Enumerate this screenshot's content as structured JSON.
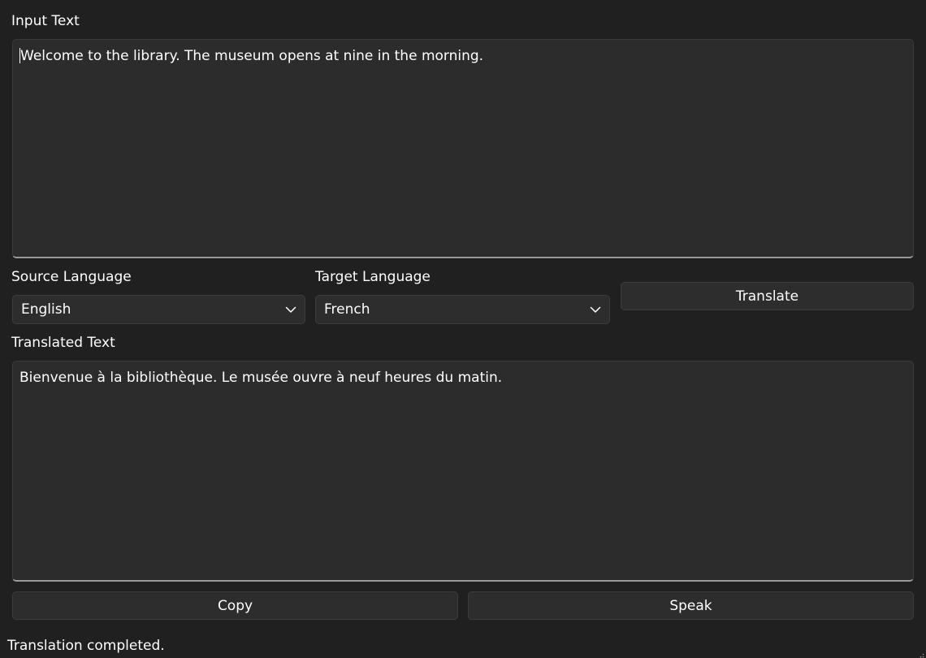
{
  "input": {
    "label": "Input Text",
    "value": "Welcome to the library. The museum opens at nine in the morning."
  },
  "source_language": {
    "label": "Source Language",
    "selected": "English"
  },
  "target_language": {
    "label": "Target Language",
    "selected": "French"
  },
  "translate_button": {
    "label": "Translate"
  },
  "output": {
    "label": "Translated Text",
    "value": "Bienvenue à la bibliothèque. Le musée ouvre à neuf heures du matin."
  },
  "actions": {
    "copy_label": "Copy",
    "speak_label": "Speak"
  },
  "status": {
    "text": "Translation completed."
  },
  "icons": {
    "dropdown": "chevron-down-icon",
    "resize": "resize-grip-icon"
  },
  "colors": {
    "background": "#202020",
    "control": "#2d2d2d",
    "text": "#ffffff"
  }
}
